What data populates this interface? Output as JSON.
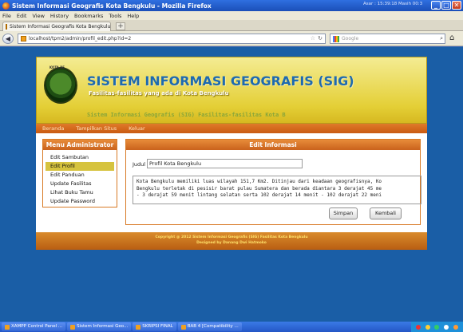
{
  "window": {
    "title": "Sistem Informasi Geografis Kota Bengkulu - Mozilla Firefox",
    "clock_text": "Asar : 15:39:18 Masih 00:3",
    "minimize": "_",
    "maximize": "□",
    "close": "✕"
  },
  "menubar": [
    "File",
    "Edit",
    "View",
    "History",
    "Bookmarks",
    "Tools",
    "Help"
  ],
  "tab": {
    "label": "Sistem Informasi Geografis Kota Bengkulu",
    "new_tab": "+"
  },
  "nav": {
    "url": "localhost/tpm2/admin/profil_edit.php?id=2",
    "search_placeholder": "Google"
  },
  "site": {
    "logo_caption": "KOTA BE",
    "title": "SISTEM INFORMASI GEOGRAFIS (SIG)",
    "tagline": "Fasilitas-fasilitas yang ada di Kota Bengkulu",
    "subtitle": "Sistem Informasi Geografis (SIG) Fasilitas-fasilitas Kota B",
    "nav": [
      "Beranda",
      "Tampilkan Situs",
      "Keluar"
    ]
  },
  "sidebar": {
    "title": "Menu Administrator",
    "items": [
      "Edit Sambutan",
      "Edit Profil",
      "Edit Panduan",
      "Update Fasilitas",
      "Lihat Buku Tamu",
      "Update Password"
    ],
    "active_index": 1
  },
  "main": {
    "title": "Edit Informasi",
    "judul_label": "Judul",
    "judul_value": "Profil Kota Bengkulu",
    "content_lines": [
      "Kota Bengkulu memiliki luas wilayah 151,7 Km2. Ditinjau dari keadaan geografisnya, Ko",
      "Bengkulu terletak di pesisir barat pulau Sumatera dan berada diantara 3 derajat 45 me",
      "- 3 derajat 59 menit lintang selatan serta 102 derajat 14 menit - 102 derajat 22 meni"
    ],
    "save_label": "Simpan",
    "back_label": "Kembali"
  },
  "footer": {
    "line1": "Copyright @ 2012 Sistem Informasi Geografis (SIG) Fasilitas Kota Bengkulu",
    "line2": "Designed by Danang Dwi Hatmoko"
  },
  "taskbar": {
    "items": [
      "XAMPP Control Panel ...",
      "Sistem Informasi Geo...",
      "SKRIPSI FINAL",
      "BAB 4 [Compatibility ..."
    ]
  }
}
